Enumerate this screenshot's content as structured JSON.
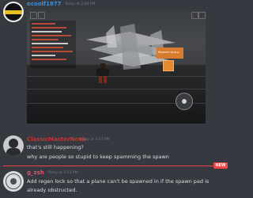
{
  "messages": [
    {
      "username": "ecoolf1877",
      "username_color": "#3b8cd8",
      "timestamp": "Today at 2:46 PM",
      "attachment": {
        "type": "game-screenshot",
        "shop_label": "Redeem to buy"
      }
    },
    {
      "username": "ClassicMasterNoob",
      "username_color": "#c83232",
      "timestamp": "Today at 2:47 PM",
      "lines": [
        "that's still happening?",
        "why are people so stupid to keep spamming the spawn"
      ]
    },
    {
      "username": "g_zsh",
      "username_color": "#e0506a",
      "timestamp": "Today at 3:53 PM",
      "lines": [
        "Add regen lock so that a plane can't be spawned in if the spawn pad is",
        "already obstructed."
      ]
    }
  ],
  "divider": {
    "badge": "NEW",
    "color": "#f04747"
  }
}
